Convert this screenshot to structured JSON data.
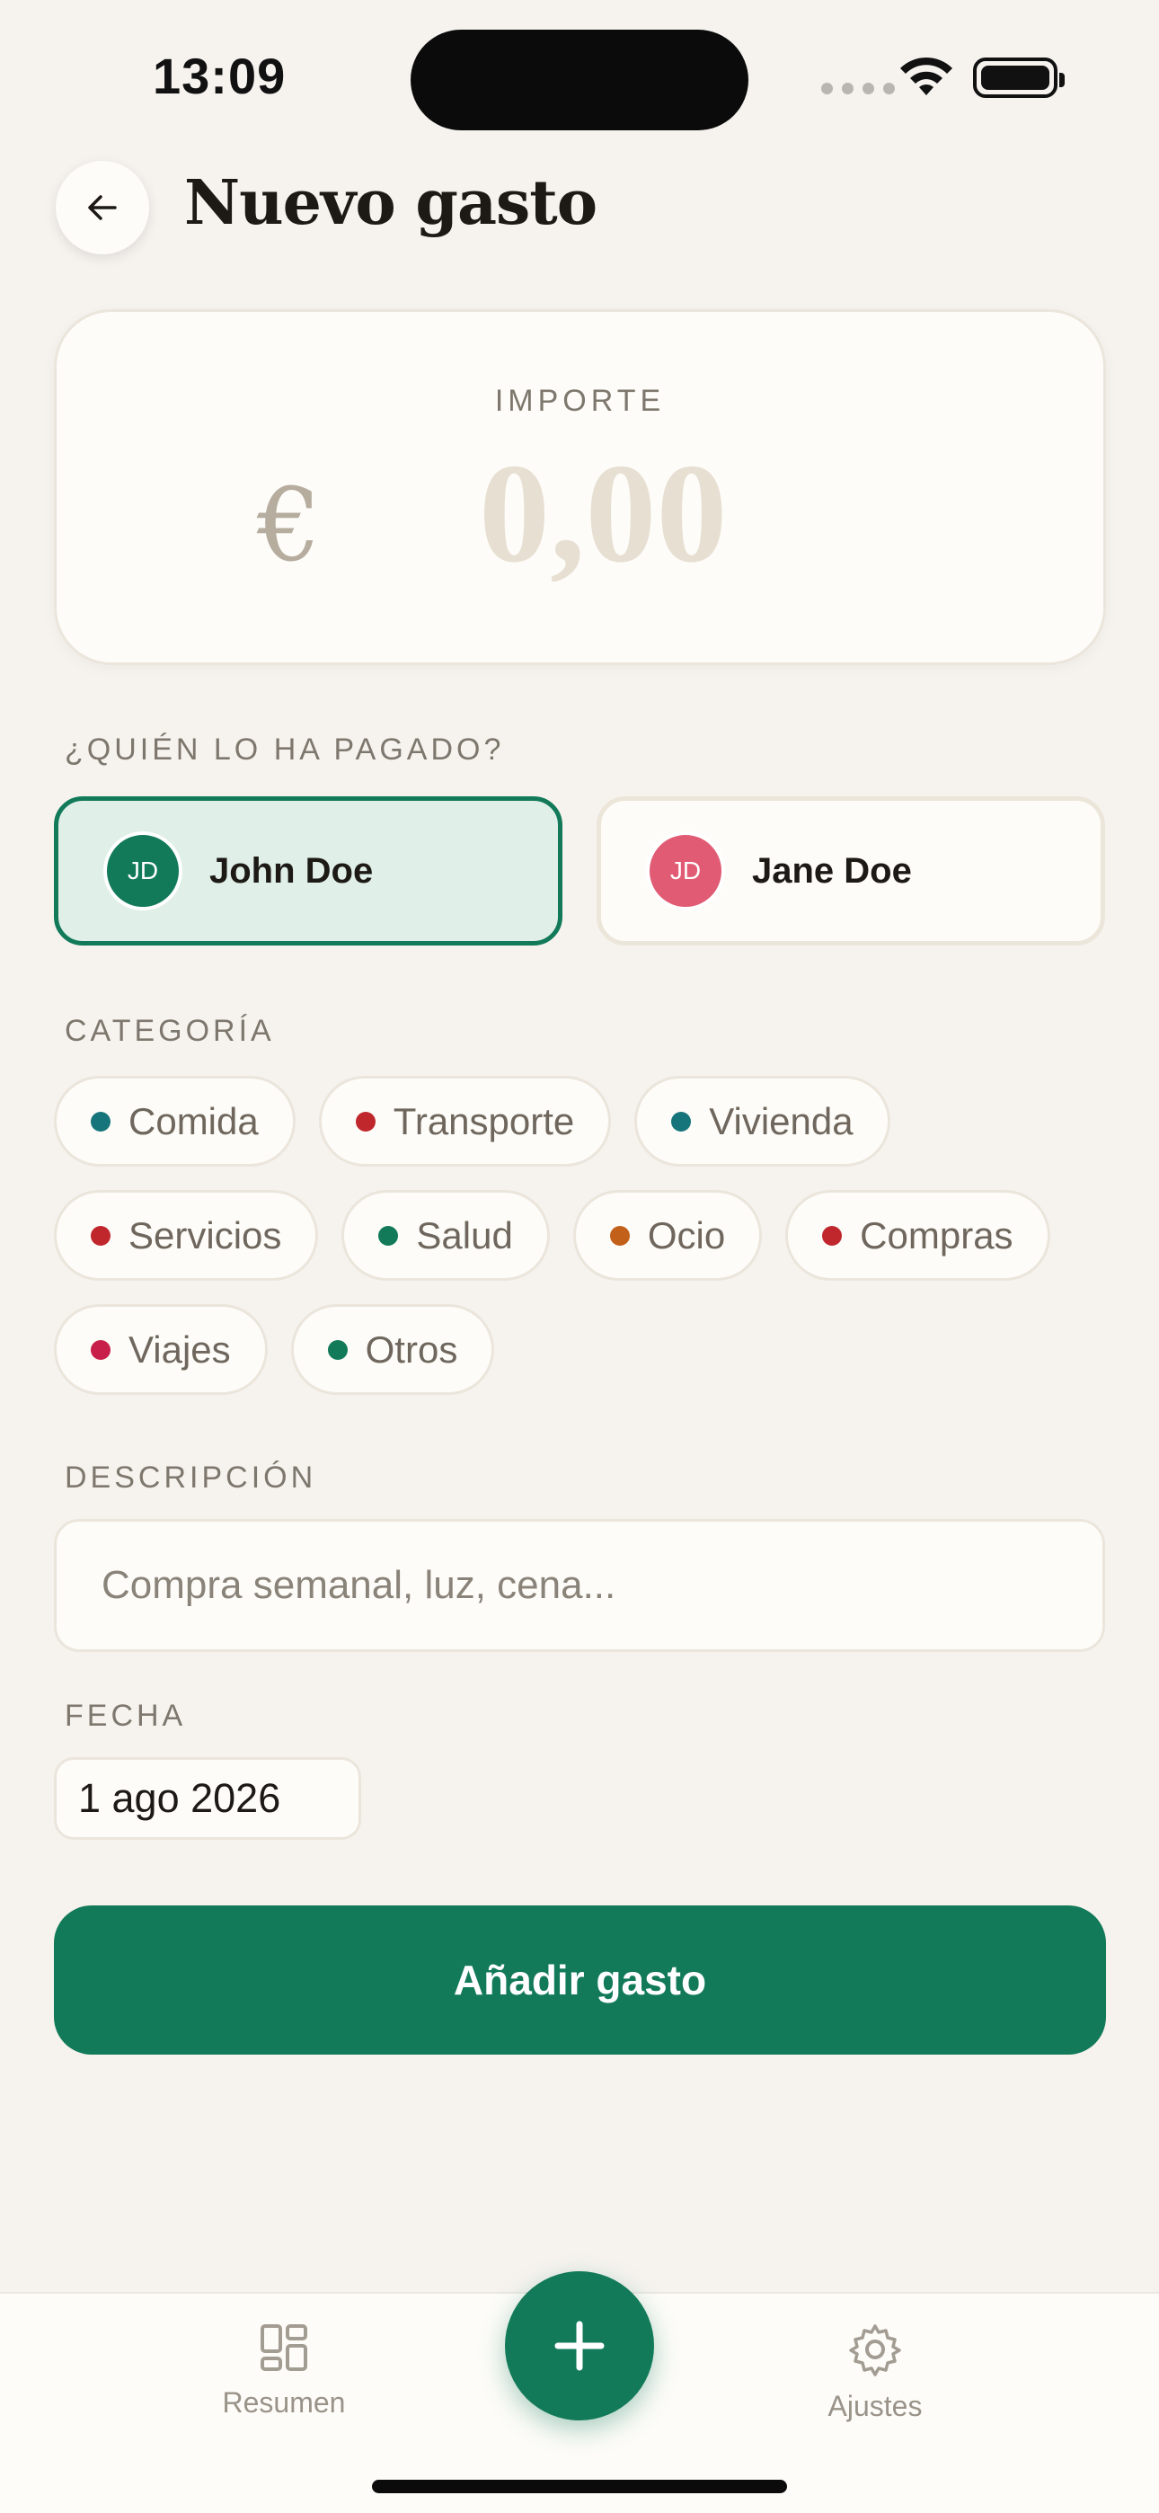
{
  "status_bar": {
    "time": "13:09"
  },
  "header": {
    "title": "Nuevo gasto"
  },
  "amount": {
    "label": "IMPORTE",
    "currency": "€",
    "placeholder": "0,00",
    "value": ""
  },
  "payer": {
    "label": "¿QUIÉN LO HA PAGADO?",
    "options": [
      {
        "initials": "JD",
        "name": "John Doe",
        "selected": true,
        "color": "#127a59"
      },
      {
        "initials": "JD",
        "name": "Jane Doe",
        "selected": false,
        "color": "#e05b73"
      }
    ]
  },
  "category": {
    "label": "CATEGORÍA",
    "items": [
      {
        "label": "Comida",
        "color": "#127a59"
      },
      {
        "label": "Transporte",
        "color": "#c0272d"
      },
      {
        "label": "Vivienda",
        "color": "#16757a"
      },
      {
        "label": "Servicios",
        "color": "#c0272d"
      },
      {
        "label": "Salud",
        "color": "#127a59"
      },
      {
        "label": "Ocio",
        "color": "#c2601a"
      },
      {
        "label": "Compras",
        "color": "#c0272d"
      },
      {
        "label": "Viajes",
        "color": "#c81e4a"
      },
      {
        "label": "Otros",
        "color": "#127a59"
      }
    ]
  },
  "description": {
    "label": "DESCRIPCIÓN",
    "placeholder": "Compra semanal, luz, cena...",
    "value": ""
  },
  "date": {
    "label": "FECHA",
    "value": "1 ago 2026"
  },
  "submit": {
    "label": "Añadir gasto"
  },
  "tabbar": {
    "items": [
      {
        "label": "Resumen",
        "icon": "dashboard-icon"
      },
      {
        "label": "Ajustes",
        "icon": "gear-icon"
      }
    ],
    "fab_icon": "plus-icon"
  },
  "colors": {
    "accent": "#127a59",
    "background": "#f6f3ef",
    "card": "#fdfcf8"
  }
}
